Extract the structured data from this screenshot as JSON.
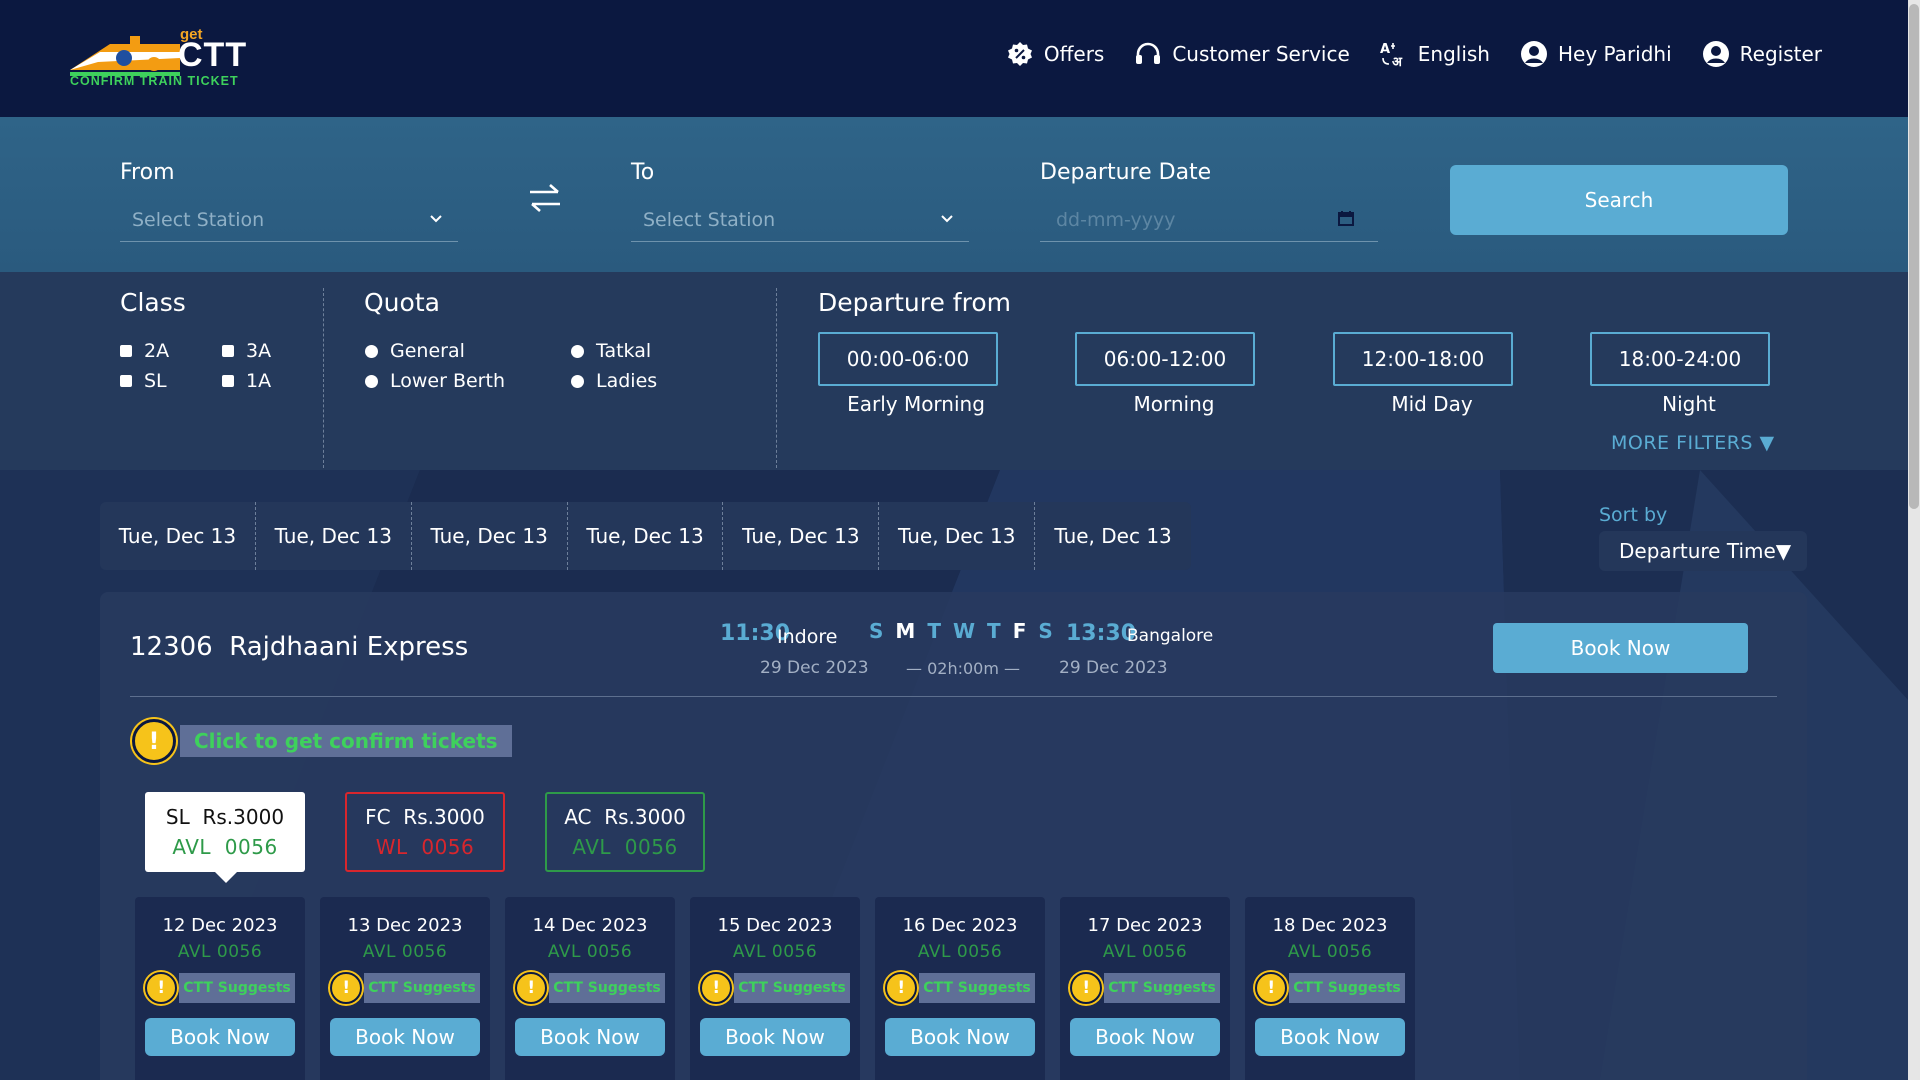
{
  "header": {
    "logo": {
      "get": "get",
      "brand": "CTT",
      "tagline": "CONFIRM TRAIN TICKET"
    },
    "nav": [
      {
        "id": "offers",
        "label": "Offers",
        "icon": "offer-badge-icon"
      },
      {
        "id": "customer-service",
        "label": "Customer Service",
        "icon": "headset-icon"
      },
      {
        "id": "language",
        "label": "English",
        "icon": "translate-icon"
      },
      {
        "id": "profile",
        "label": "Hey Paridhi",
        "icon": "user-circle-icon"
      },
      {
        "id": "register",
        "label": "Register",
        "icon": "user-circle-icon"
      }
    ]
  },
  "search": {
    "from_label": "From",
    "from_placeholder": "Select Station",
    "to_label": "To",
    "to_placeholder": "Select Station",
    "date_label": "Departure Date",
    "date_placeholder": "dd-mm-yyyy",
    "search_button": "Search"
  },
  "filters": {
    "class_title": "Class",
    "classes": [
      "2A",
      "3A",
      "SL",
      "1A"
    ],
    "quota_title": "Quota",
    "quotas": [
      "General",
      "Tatkal",
      "Lower Berth",
      "Ladies"
    ],
    "departure_title": "Departure from",
    "time_slots": [
      {
        "range": "00:00-06:00",
        "caption": "Early Morning"
      },
      {
        "range": "06:00-12:00",
        "caption": "Morning"
      },
      {
        "range": "12:00-18:00",
        "caption": "Mid Day"
      },
      {
        "range": "18:00-24:00",
        "caption": "Night"
      }
    ],
    "more_filters": "MORE FILTERS ▼"
  },
  "date_strip": [
    "Tue, Dec 13",
    "Tue, Dec 13",
    "Tue, Dec 13",
    "Tue, Dec 13",
    "Tue, Dec 13",
    "Tue, Dec 13",
    "Tue, Dec 13"
  ],
  "sort": {
    "label": "Sort by",
    "value": "Departure Time▼"
  },
  "train": {
    "number": "12306",
    "name": "Rajdhaani Express",
    "dep_time": "11:30",
    "dep_station": "Indore",
    "dep_date": "29 Dec 2023",
    "days": [
      "S",
      "M",
      "T",
      "W",
      "T",
      "F",
      "S"
    ],
    "duration": "— 02h:00m —",
    "arr_time": "13:30",
    "arr_station": "Bangalore",
    "arr_date": "29 Dec 2023",
    "book_now": "Book Now",
    "suggest_text": "Click to get confirm tickets",
    "classes": [
      {
        "code": "SL",
        "price": "Rs.3000",
        "status": "AVL",
        "count": "0056"
      },
      {
        "code": "FC",
        "price": "Rs.3000",
        "status": "WL",
        "count": "0056"
      },
      {
        "code": "AC",
        "price": "Rs.3000",
        "status": "AVL",
        "count": "0056"
      }
    ],
    "availability": [
      {
        "date": "12 Dec 2023",
        "status": "AVL  0056",
        "suggest": "CTT Suggests",
        "book": "Book Now"
      },
      {
        "date": "13 Dec 2023",
        "status": "AVL  0056",
        "suggest": "CTT Suggests",
        "book": "Book Now"
      },
      {
        "date": "14 Dec 2023",
        "status": "AVL  0056",
        "suggest": "CTT Suggests",
        "book": "Book Now"
      },
      {
        "date": "15 Dec 2023",
        "status": "AVL  0056",
        "suggest": "CTT Suggests",
        "book": "Book Now"
      },
      {
        "date": "16 Dec 2023",
        "status": "AVL  0056",
        "suggest": "CTT Suggests",
        "book": "Book Now"
      },
      {
        "date": "17 Dec 2023",
        "status": "AVL  0056",
        "suggest": "CTT Suggests",
        "book": "Book Now"
      },
      {
        "date": "18 Dec 2023",
        "status": "AVL  0056",
        "suggest": "CTT Suggests",
        "book": "Book Now"
      }
    ]
  },
  "colors": {
    "header_bg": "#0b1840",
    "accent": "#5aacd3",
    "available": "#2e9a49",
    "waitlist": "#d8262d",
    "suggest": "#3ed15c",
    "warning": "#f6c31a"
  }
}
